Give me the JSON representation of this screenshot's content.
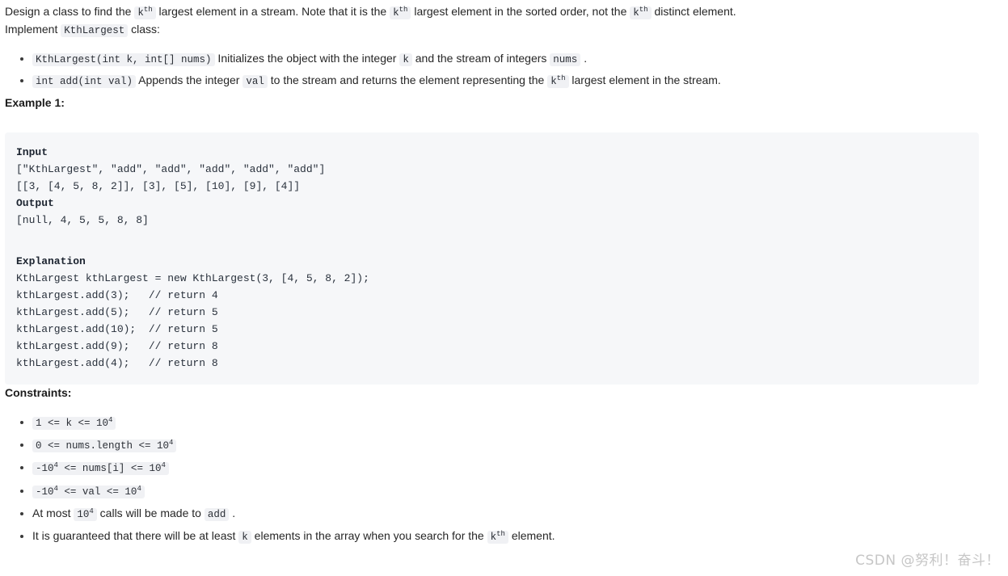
{
  "document": {
    "intro": {
      "seg1": "Design a class to find the ",
      "code1": "k",
      "code1_sup": "th",
      "seg2": " largest element in a stream. Note that it is the ",
      "code2": "k",
      "code2_sup": "th",
      "seg3": " largest element in the sorted order, not the ",
      "code3": "k",
      "code3_sup": "th",
      "seg4": " distinct element."
    },
    "implement": {
      "seg1": "Implement ",
      "code1": "KthLargest",
      "seg2": " class:"
    },
    "methods": [
      {
        "code1": "KthLargest(int k, int[] nums)",
        "seg1": " Initializes the object with the integer ",
        "code2": "k",
        "seg2": " and the stream of integers ",
        "code3": "nums",
        "seg3": " ."
      },
      {
        "code1": "int add(int val)",
        "seg1": " Appends the integer ",
        "code2": "val",
        "seg2": " to the stream and returns the element representing the ",
        "code3": "k",
        "code3_sup": "th",
        "seg3": " largest element in the stream."
      }
    ],
    "example_heading": "Example 1:",
    "example": {
      "input_label": "Input",
      "input_line1": "[\"KthLargest\", \"add\", \"add\", \"add\", \"add\", \"add\"]",
      "input_line2": "[[3, [4, 5, 8, 2]], [3], [5], [10], [9], [4]]",
      "output_label": "Output",
      "output_line": "[null, 4, 5, 5, 8, 8]",
      "explanation_label": "Explanation",
      "explanation_lines": [
        "KthLargest kthLargest = new KthLargest(3, [4, 5, 8, 2]);",
        "kthLargest.add(3);   // return 4",
        "kthLargest.add(5);   // return 5",
        "kthLargest.add(10);  // return 5",
        "kthLargest.add(9);   // return 8",
        "kthLargest.add(4);   // return 8"
      ]
    },
    "constraints_heading": "Constraints:",
    "constraints": [
      {
        "kind": "code",
        "pre": "1 <= k <= 10",
        "sup": "4",
        "post": ""
      },
      {
        "kind": "code",
        "pre": "0 <= nums.length <= 10",
        "sup": "4",
        "post": ""
      },
      {
        "kind": "code3",
        "a": "-10",
        "a_sup": "4",
        "b": " <= nums[i] <= 10",
        "b_sup": "4"
      },
      {
        "kind": "code3",
        "a": "-10",
        "a_sup": "4",
        "b": " <= val <= 10",
        "b_sup": "4"
      },
      {
        "kind": "text",
        "seg1": "At most ",
        "code1": "10",
        "code1_sup": "4",
        "seg2": " calls will be made to ",
        "code2": "add",
        "seg3": " ."
      },
      {
        "kind": "text",
        "seg1": "It is guaranteed that there will be at least ",
        "code1": "k",
        "seg2": " elements in the array when you search for the ",
        "code2": "k",
        "code2_sup": "th",
        "seg3": " element."
      }
    ],
    "watermark": "CSDN @努利！奋斗！"
  },
  "colors": {
    "page_background": "#ffffff",
    "text": "#262626",
    "inline_code_background": "#f0f1f4",
    "code_block_background": "#f6f7f9",
    "code_text": "#29313c",
    "watermark": "#c6c6c6"
  }
}
